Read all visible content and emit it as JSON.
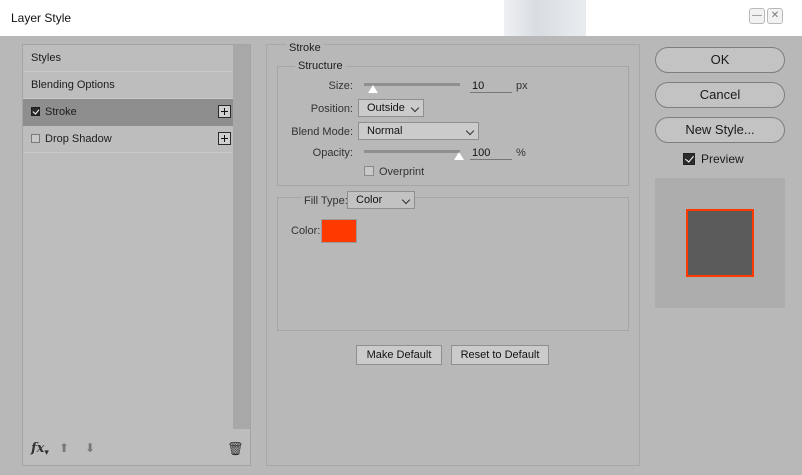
{
  "window": {
    "title": "Layer Style"
  },
  "colors": {
    "stroke": "#ff3a00",
    "preview_fill": "#5b5b5b",
    "dialog_bg": "#b8b8b8"
  },
  "left_panel": {
    "items": [
      {
        "label": "Styles",
        "has_checkbox": false,
        "checked": false,
        "selected": false
      },
      {
        "label": "Blending Options",
        "has_checkbox": false,
        "checked": false,
        "selected": false
      },
      {
        "label": "Stroke",
        "has_checkbox": true,
        "checked": true,
        "selected": true
      },
      {
        "label": "Drop Shadow",
        "has_checkbox": true,
        "checked": false,
        "selected": false
      }
    ],
    "footer": {
      "fx_label": "fx",
      "icons": [
        "move-up-icon",
        "move-down-icon",
        "trash-icon"
      ]
    }
  },
  "stroke": {
    "section_title": "Stroke",
    "structure_title": "Structure",
    "size_label": "Size:",
    "size_value": "10",
    "size_unit": "px",
    "position_label": "Position:",
    "position_value": "Outside",
    "blend_mode_label": "Blend Mode:",
    "blend_mode_value": "Normal",
    "opacity_label": "Opacity:",
    "opacity_value": "100",
    "opacity_unit": "%",
    "overprint_label": "Overprint",
    "overprint_checked": false,
    "fill_type_label": "Fill Type:",
    "fill_type_value": "Color",
    "color_label": "Color:"
  },
  "buttons": {
    "make_default": "Make Default",
    "reset_to_default": "Reset to Default",
    "ok": "OK",
    "cancel": "Cancel",
    "new_style": "New Style..."
  },
  "preview": {
    "label": "Preview",
    "checked": true
  }
}
